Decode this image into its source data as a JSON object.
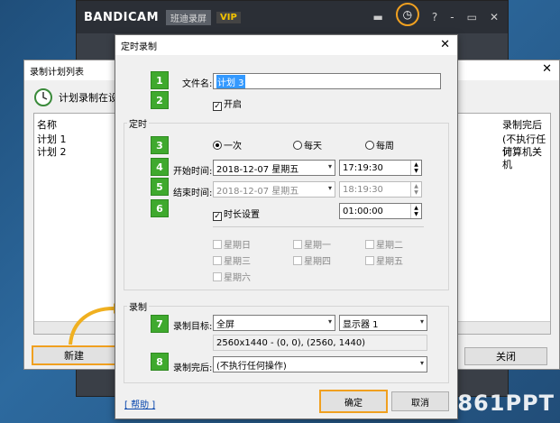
{
  "bandicam": {
    "logo": "BANDICAM",
    "subtitle": "班迪录屏",
    "vip": "VIP",
    "buttons": {
      "folder": "▬",
      "clock": "◷",
      "help": "?",
      "min": "-",
      "max": "▭",
      "close": "✕"
    }
  },
  "list_dialog": {
    "title": "录制计划列表",
    "close": "✕",
    "header": "计划录制在设",
    "columns": {
      "name": "名称",
      "end": "录制完后"
    },
    "rows": [
      {
        "name": "计划 1",
        "end": "(不执行任何"
      },
      {
        "name": "计划 2",
        "end": "计算机关机"
      }
    ],
    "new_btn": "新建",
    "close_btn": "关闭"
  },
  "dialog": {
    "title": "定时录制",
    "close": "✕",
    "filename_label": "文件名:",
    "filename_value": "计划 3",
    "enable_label": "开启",
    "timing_group": "定时",
    "radio_once": "一次",
    "radio_daily": "每天",
    "radio_weekly": "每周",
    "start_label": "开始时间:",
    "start_date": "2018-12-07 星期五",
    "start_time": "17:19:30",
    "end_label": "结束时间:",
    "end_date": "2018-12-07 星期五",
    "end_time": "18:19:30",
    "duration_label": "时长设置",
    "duration_value": "01:00:00",
    "weekdays": [
      "星期日",
      "星期一",
      "星期二",
      "星期三",
      "星期四",
      "星期五",
      "星期六"
    ],
    "record_group": "录制",
    "target_label": "录制目标:",
    "target_value": "全屏",
    "display_value": "显示器 1",
    "target_info": "2560x1440 - (0, 0), (2560, 1440)",
    "after_label": "录制完后:",
    "after_value": "(不执行任何操作)",
    "help_link": "[ 帮助 ]",
    "ok_btn": "确定",
    "cancel_btn": "取消"
  },
  "steps": [
    "1",
    "2",
    "3",
    "4",
    "5",
    "6",
    "7",
    "8"
  ],
  "watermark": "861PPT",
  "colors": {
    "step_green": "#3fa92e",
    "highlight_orange": "#f0a020"
  }
}
